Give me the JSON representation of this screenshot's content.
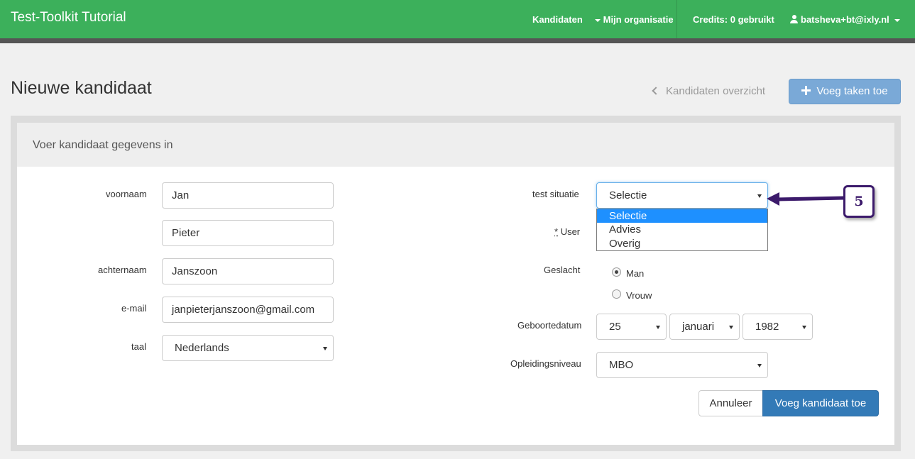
{
  "navbar": {
    "brand": "Test-Toolkit Tutorial",
    "candidates": "Kandidaten",
    "organization": "Mijn organisatie",
    "credits": "Credits: 0 gebruikt",
    "user": "batsheva+bt@ixly.nl",
    "color": "#3cb05b"
  },
  "page": {
    "title": "Nieuwe kandidaat",
    "back_link": "Kandidaten overzicht",
    "add_tasks_button": "Voeg taken toe"
  },
  "panel": {
    "heading": "Voer kandidaat gegevens in"
  },
  "form_left": {
    "firstname_label": "voornaam",
    "firstname_value": "Jan",
    "middlename_value": "Pieter",
    "lastname_label": "achternaam",
    "lastname_value": "Janszoon",
    "email_label": "e-mail",
    "email_value": "janpieterjanszoon@gmail.com",
    "language_label": "taal",
    "language_value": "Nederlands"
  },
  "form_right": {
    "test_situation_label": "test situatie",
    "test_situation_value": "Selectie",
    "test_situation_options": [
      "Selectie",
      "Advies",
      "Overig"
    ],
    "user_label_star": "*",
    "user_label": "User",
    "gender_label": "Geslacht",
    "gender_options": [
      "Man",
      "Vrouw"
    ],
    "gender_selected": "Man",
    "birthdate_label": "Geboortedatum",
    "birth_day": "25",
    "birth_month": "januari",
    "birth_year": "1982",
    "education_label": "Opleidingsniveau",
    "education_value": "MBO"
  },
  "actions": {
    "cancel": "Annuleer",
    "submit": "Voeg kandidaat toe"
  },
  "annotation": {
    "step_number": "5",
    "color": "#3c1a6b"
  }
}
